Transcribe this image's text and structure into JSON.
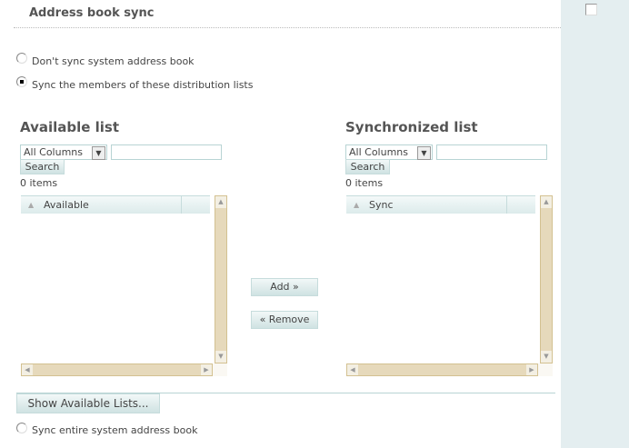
{
  "header": {
    "title": "Address book sync"
  },
  "options": {
    "dont_sync": "Don't sync system address book",
    "sync_members": "Sync the members of these distribution lists",
    "sync_entire": "Sync entire system address book",
    "selected": "sync_members"
  },
  "available": {
    "heading": "Available list",
    "filter": "All Columns",
    "search_value": "",
    "search_label": "Search",
    "count": "0 items",
    "column": "Available"
  },
  "synchronized": {
    "heading": "Synchronized list",
    "filter": "All Columns",
    "search_value": "",
    "search_label": "Search",
    "count": "0 items",
    "column": "Sync"
  },
  "actions": {
    "add": "Add »",
    "remove": "« Remove",
    "show_lists": "Show Available Lists..."
  }
}
